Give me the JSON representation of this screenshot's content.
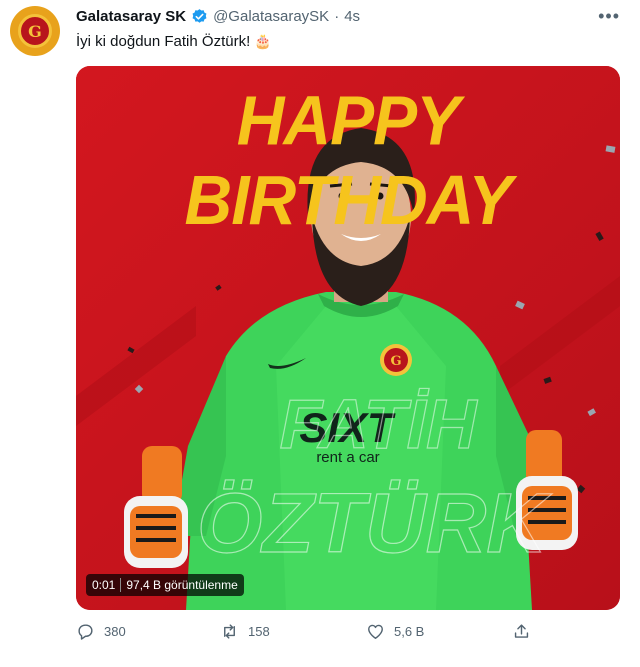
{
  "tweet": {
    "account_name": "Galatasaray SK",
    "handle": "@GalatasaraySK",
    "separator": "·",
    "time": "4s",
    "text": "İyi ki doğdun Fatih Öztürk!",
    "emoji": "🎂",
    "more_label": "•••"
  },
  "media": {
    "headline": "HAPPY BIRTHDAY",
    "sponsor_brand": "SIXT",
    "sponsor_tagline": "rent a car",
    "player_name_line1": "FATİH",
    "player_name_line2": "ÖZTÜRK",
    "video_time": "0:01",
    "views": "97,4 B görüntülenme",
    "colors": {
      "background": "#c8141e",
      "headline": "#f6c41d",
      "jersey": "#3ed35a",
      "glove": "#f07a22"
    }
  },
  "actions": {
    "replies": "380",
    "retweets": "158",
    "likes": "5,6 B"
  },
  "icons": [
    "verified-badge-icon",
    "more-icon",
    "reply-icon",
    "retweet-icon",
    "like-icon",
    "share-icon"
  ]
}
